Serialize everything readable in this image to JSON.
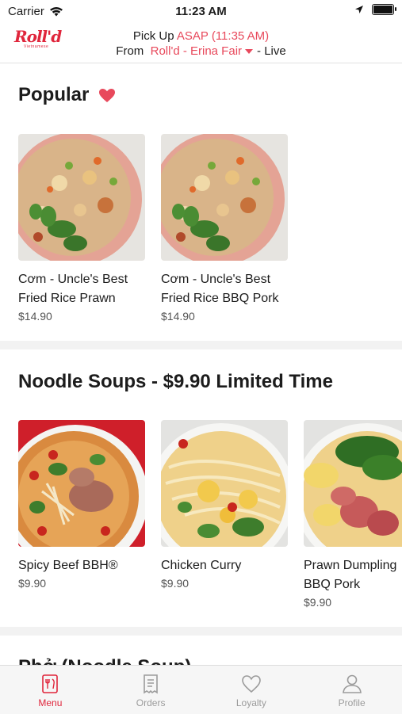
{
  "status_bar": {
    "carrier": "Carrier",
    "time": "11:23 AM"
  },
  "header": {
    "logo_text": "Roll'd",
    "logo_sub": "Vietnamese",
    "pickup_prefix": "Pick Up",
    "pickup_time": "ASAP (11:35 AM)",
    "from_prefix": "From",
    "store": "Roll'd - Erina Fair",
    "status_suffix": "- Live"
  },
  "sections": [
    {
      "title": "Popular",
      "items": [
        {
          "name_line1": "Cơm - Uncle's Best",
          "name_line2": "Fried Rice Prawn",
          "price": "$14.90"
        },
        {
          "name_line1": "Cơm - Uncle's Best",
          "name_line2": "Fried Rice BBQ Pork",
          "price": "$14.90"
        }
      ]
    },
    {
      "title": "Noodle Soups - $9.90 Limited Time",
      "items": [
        {
          "name_line1": "Spicy Beef BBH®",
          "name_line2": "",
          "price": "$9.90"
        },
        {
          "name_line1": "Chicken Curry",
          "name_line2": "",
          "price": "$9.90"
        },
        {
          "name_line1": "Prawn Dumpling",
          "name_line2": "BBQ Pork",
          "price": "$9.90"
        }
      ]
    },
    {
      "title": "Phở (Noodle Soup)"
    }
  ],
  "tabs": [
    {
      "label": "Menu",
      "icon": "menu-icon",
      "active": true
    },
    {
      "label": "Orders",
      "icon": "orders-icon",
      "active": false
    },
    {
      "label": "Loyalty",
      "icon": "heart-icon",
      "active": false
    },
    {
      "label": "Profile",
      "icon": "profile-icon",
      "active": false
    }
  ],
  "colors": {
    "accent": "#e8495c",
    "brand": "#e0263c"
  }
}
